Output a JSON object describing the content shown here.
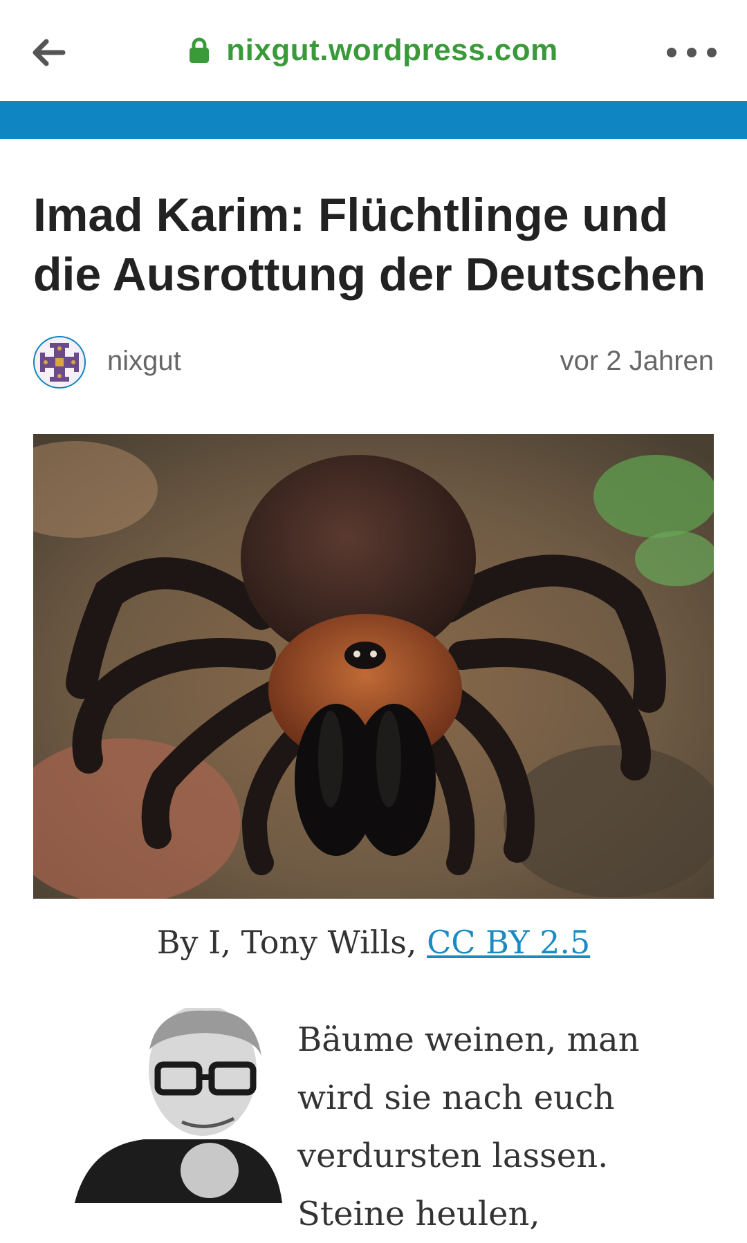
{
  "browser": {
    "url": "nixgut.wordpress.com",
    "back_icon": "arrow-left-icon",
    "lock_icon": "lock-icon",
    "menu_icon": "more-horizontal-icon",
    "url_color": "#3a9a3a",
    "accent_color": "#0f85c1"
  },
  "post": {
    "title": "Imad Karim: Flüchtlinge und die Ausrottung der Deutschen",
    "author": "nixgut",
    "date": "vor 2 Jahren",
    "caption_prefix": "By I, Tony Wills,",
    "caption_link": "CC BY 2.5",
    "body_start": "Bäume weinen, man wird sie nach euch verdursten lassen. Steine heulen,"
  }
}
